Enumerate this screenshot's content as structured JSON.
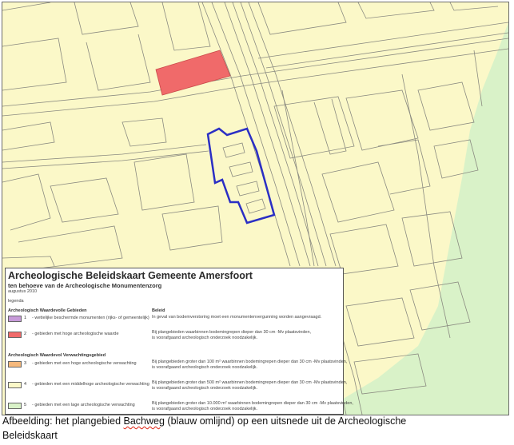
{
  "map": {
    "colors": {
      "background": "#fbf8c8",
      "lines": "#8a8a80",
      "monument": "#f06a6a",
      "plan_area_outline": "#2b2fc4",
      "low_value_zone": "#d9f2c8"
    }
  },
  "legend": {
    "title": "Archeologische Beleidskaart Gemeente Amersfoort",
    "subtitle": "ten behoeve van de Archeologische Monumentenzorg",
    "date": "augustus 2010",
    "legenda_label": "legenda",
    "section1_heading": "Archeologisch Waardevolle Gebieden",
    "beleid_heading": "Beleid",
    "section2_heading": "Archeologisch Waardevol Verwachtingsgebied",
    "items": [
      {
        "num": "1",
        "color": "#c79ad9",
        "desc": "- wettelijke beschermde monumenten (rijks- of gemeentelijk)",
        "rule1": "In geval van bodemverstoring moet een monumentenvergunning worden aangevraagd.",
        "rule2": ""
      },
      {
        "num": "2",
        "color": "#f06a6a",
        "desc": "- gebieden met hoge archeologische waarde",
        "rule1": "Bij plangebieden waarbinnen bodemingrepen dieper dan 30 cm -Mv plaatsvinden,",
        "rule2": "is voorafgaand archeologisch onderzoek noodzakelijk."
      },
      {
        "num": "3",
        "color": "#f5b87c",
        "desc": "- gebieden met een hoge archeologische verwachting",
        "rule1": "Bij plangebieden groter dan 100 m² waarbinnen bodemingrepen dieper dan 30 cm -Mv plaatsvinden,",
        "rule2": "is voorafgaand archeologisch onderzoek noodzakelijk."
      },
      {
        "num": "4",
        "color": "#fbf8c8",
        "desc": "- gebieden met een middelhoge archeologische verwachting",
        "rule1": "Bij plangebieden groter dan 500 m² waarbinnen bodemingrepen dieper dan 30 cm -Mv plaatsvinden,",
        "rule2": "is voorafgaand archeologisch onderzoek noodzakelijk."
      },
      {
        "num": "5",
        "color": "#d9f2c8",
        "desc": "- gebieden met een lage archeologische verwachting",
        "rule1": "Bij plangebieden groter dan 10.000 m² waarbinnen bodemingrepen dieper dan 30 cm -Mv plaatsvinden,",
        "rule2": "is voorafgaand archeologisch onderzoek noodzakelijk."
      }
    ]
  },
  "caption": {
    "part1": "Afbeelding: het plangebied ",
    "highlight": "Bachweg",
    "part2": " (blauw omlijnd) op een uitsnede uit de Archeologische",
    "line2": "Beleidskaart"
  }
}
